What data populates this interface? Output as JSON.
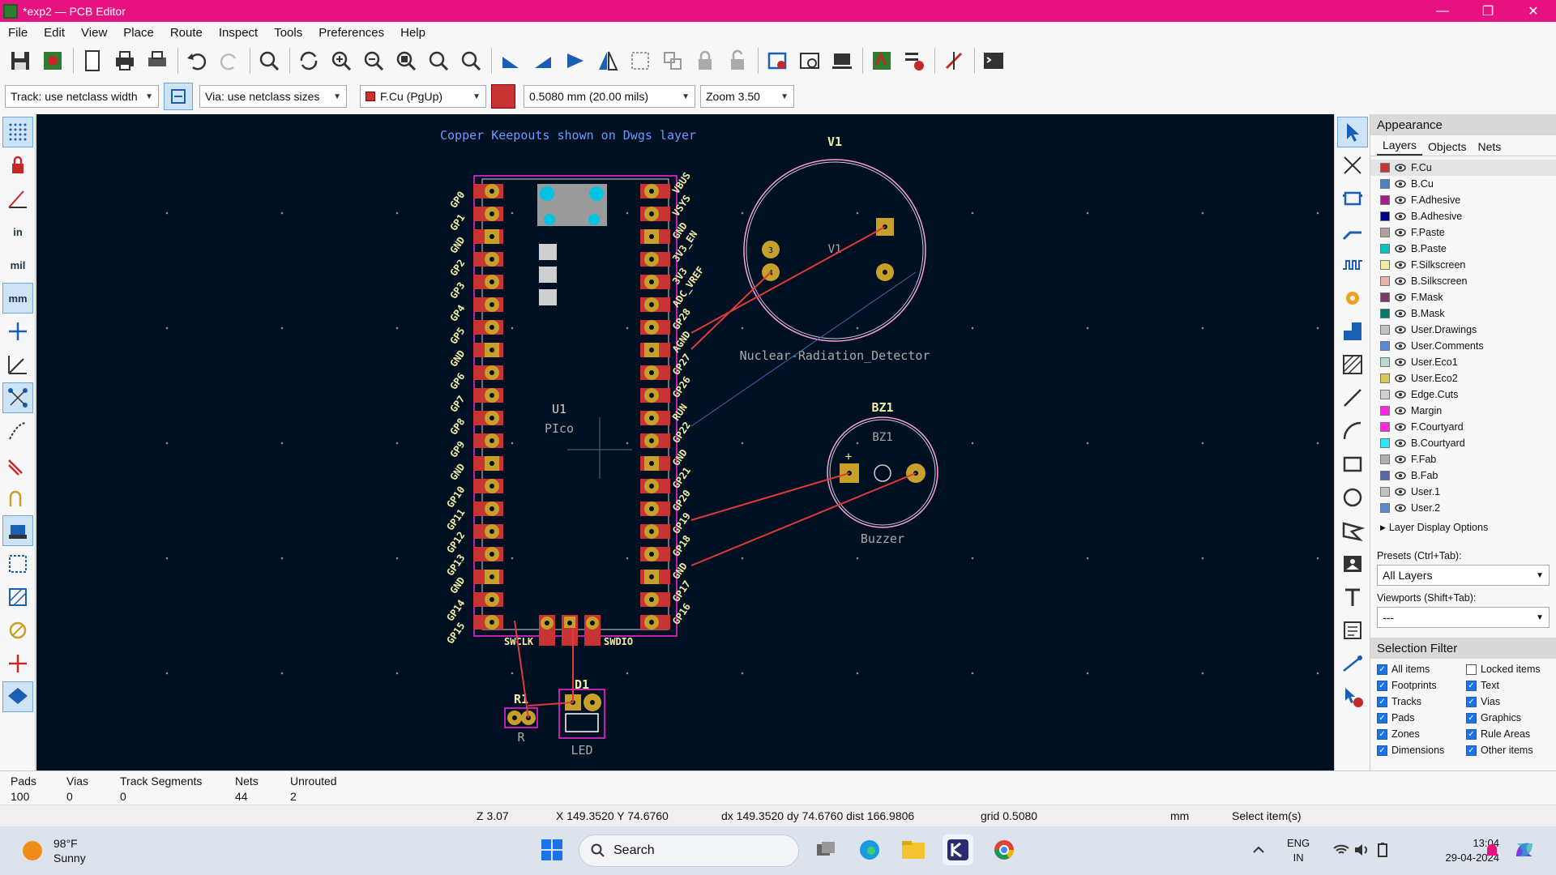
{
  "window": {
    "title": "*exp2 — PCB Editor",
    "controls": {
      "minimize": "—",
      "maximize": "❐",
      "close": "✕"
    }
  },
  "menu": [
    "File",
    "Edit",
    "View",
    "Place",
    "Route",
    "Inspect",
    "Tools",
    "Preferences",
    "Help"
  ],
  "options": {
    "track": "Track: use netclass width",
    "via": "Via: use netclass sizes",
    "layer": "F.Cu (PgUp)",
    "grid": "0.5080 mm (20.00 mils)",
    "zoom": "Zoom 3.50"
  },
  "left_toolbar": {
    "units_in": "in",
    "units_mil": "mil",
    "units_mm": "mm"
  },
  "canvas": {
    "keepout_note": "Copper Keepouts shown on Dwgs layer",
    "u1": {
      "ref": "U1",
      "value": "PIco",
      "pins_left": [
        "GP0",
        "GP1",
        "GND",
        "GP2",
        "GP3",
        "GP4",
        "GP5",
        "GND",
        "GP6",
        "GP7",
        "GP8",
        "GP9",
        "GND",
        "GP10",
        "GP11",
        "GP12",
        "GP13",
        "GND",
        "GP14",
        "GP15"
      ],
      "pins_right": [
        "VBUS",
        "VSYS",
        "GND",
        "3V3_EN",
        "3V3",
        "ADC_VREF",
        "GP28",
        "AGND",
        "GP27",
        "GP26",
        "RUN",
        "GP22",
        "GND",
        "GP21",
        "GP20",
        "GP19",
        "GP18",
        "GND",
        "GP17",
        "GP16"
      ],
      "swclk": "SWCLK",
      "swdio": "SWDIO"
    },
    "v1": {
      "ref": "V1",
      "ref_inner": "V1",
      "value": "Nuclear-Radiation_Detector",
      "pad3": "3",
      "pad4": "4"
    },
    "bz1": {
      "ref": "BZ1",
      "ref_inner": "BZ1",
      "value": "Buzzer",
      "plus": "+"
    },
    "r1": {
      "ref": "R1",
      "value": "R"
    },
    "d1": {
      "ref": "D1",
      "value": "LED"
    }
  },
  "panel": {
    "title": "Appearance",
    "tabs": [
      "Layers",
      "Objects",
      "Nets"
    ],
    "layers": [
      {
        "name": "F.Cu",
        "color": "#c83434"
      },
      {
        "name": "B.Cu",
        "color": "#4d7fc4"
      },
      {
        "name": "F.Adhesive",
        "color": "#a61e8c"
      },
      {
        "name": "B.Adhesive",
        "color": "#000080"
      },
      {
        "name": "F.Paste",
        "color": "#b4a09a"
      },
      {
        "name": "B.Paste",
        "color": "#00c2c2"
      },
      {
        "name": "F.Silkscreen",
        "color": "#f2eda1"
      },
      {
        "name": "B.Silkscreen",
        "color": "#e8b2a7"
      },
      {
        "name": "F.Mask",
        "color": "#7a3a6e"
      },
      {
        "name": "B.Mask",
        "color": "#02786e"
      },
      {
        "name": "User.Drawings",
        "color": "#c2c2c2"
      },
      {
        "name": "User.Comments",
        "color": "#5988d6"
      },
      {
        "name": "User.Eco1",
        "color": "#b4dbd2"
      },
      {
        "name": "User.Eco2",
        "color": "#d8c858"
      },
      {
        "name": "Edge.Cuts",
        "color": "#d0d2cd"
      },
      {
        "name": "Margin",
        "color": "#ff26e2"
      },
      {
        "name": "F.Courtyard",
        "color": "#ff26e2"
      },
      {
        "name": "B.Courtyard",
        "color": "#26e9ff"
      },
      {
        "name": "F.Fab",
        "color": "#afafaf"
      },
      {
        "name": "B.Fab",
        "color": "#5866a8"
      },
      {
        "name": "User.1",
        "color": "#c2c2c2"
      },
      {
        "name": "User.2",
        "color": "#5988d6"
      }
    ],
    "layer_display_options": "Layer Display Options",
    "presets_label": "Presets (Ctrl+Tab):",
    "presets_value": "All Layers",
    "viewports_label": "Viewports (Shift+Tab):",
    "viewports_value": "---",
    "selection_filter_title": "Selection Filter",
    "filters": [
      {
        "label": "All items",
        "checked": true
      },
      {
        "label": "Locked items",
        "checked": false
      },
      {
        "label": "Footprints",
        "checked": true
      },
      {
        "label": "Text",
        "checked": true
      },
      {
        "label": "Tracks",
        "checked": true
      },
      {
        "label": "Vias",
        "checked": true
      },
      {
        "label": "Pads",
        "checked": true
      },
      {
        "label": "Graphics",
        "checked": true
      },
      {
        "label": "Zones",
        "checked": true
      },
      {
        "label": "Rule Areas",
        "checked": true
      },
      {
        "label": "Dimensions",
        "checked": true
      },
      {
        "label": "Other items",
        "checked": true
      }
    ]
  },
  "status": {
    "pads_label": "Pads",
    "pads": "100",
    "vias_label": "Vias",
    "vias": "0",
    "tracks_label": "Track Segments",
    "tracks": "0",
    "nets_label": "Nets",
    "nets": "44",
    "unrouted_label": "Unrouted",
    "unrouted": "2",
    "z": "Z 3.07",
    "xy": "X 149.3520  Y 74.6760",
    "delta": "dx 149.3520  dy 74.6760  dist 166.9806",
    "grid": "grid 0.5080",
    "units": "mm",
    "mode": "Select item(s)"
  },
  "taskbar": {
    "temp": "98°F",
    "condition": "Sunny",
    "search": "Search",
    "lang1": "ENG",
    "lang2": "IN",
    "time": "13:04",
    "date": "29-04-2024"
  }
}
